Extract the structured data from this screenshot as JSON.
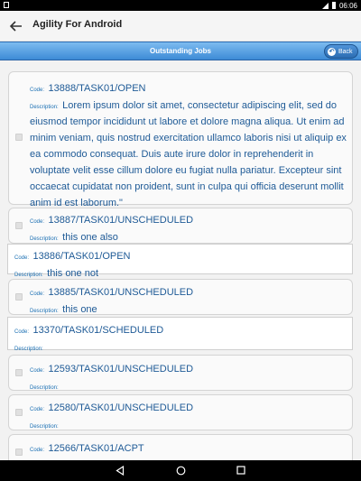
{
  "status_bar": {
    "time": "06:06"
  },
  "app_bar": {
    "title": "Agility For Android"
  },
  "header": {
    "title": "Outstanding Jobs",
    "back_label": "Back"
  },
  "labels": {
    "code": "Code:",
    "description": "Description:"
  },
  "jobs": [
    {
      "code": "13888/TASK01/OPEN",
      "description": "Lorem ipsum dolor sit amet, consectetur adipiscing elit, sed do eiusmod tempor incididunt ut labore et dolore magna aliqua. Ut enim ad minim veniam, quis nostrud exercitation ullamco laboris nisi ut aliquip ex ea commodo consequat. Duis aute irure dolor in reprehenderit in voluptate velit esse cillum dolore eu fugiat nulla pariatur. Excepteur sint occaecat cupidatat non proident, sunt in culpa qui officia deserunt mollit anim id est laborum.\""
    },
    {
      "code": "13887/TASK01/UNSCHEDULED",
      "description": "this one also"
    },
    {
      "code": "13886/TASK01/OPEN",
      "description": "this one not"
    },
    {
      "code": "13885/TASK01/UNSCHEDULED",
      "description": "this one"
    },
    {
      "code": "13370/TASK01/SCHEDULED",
      "description": ""
    },
    {
      "code": "12593/TASK01/UNSCHEDULED",
      "description": ""
    },
    {
      "code": "12580/TASK01/UNSCHEDULED",
      "description": ""
    },
    {
      "code": "12566/TASK01/ACPT",
      "description": ""
    }
  ]
}
